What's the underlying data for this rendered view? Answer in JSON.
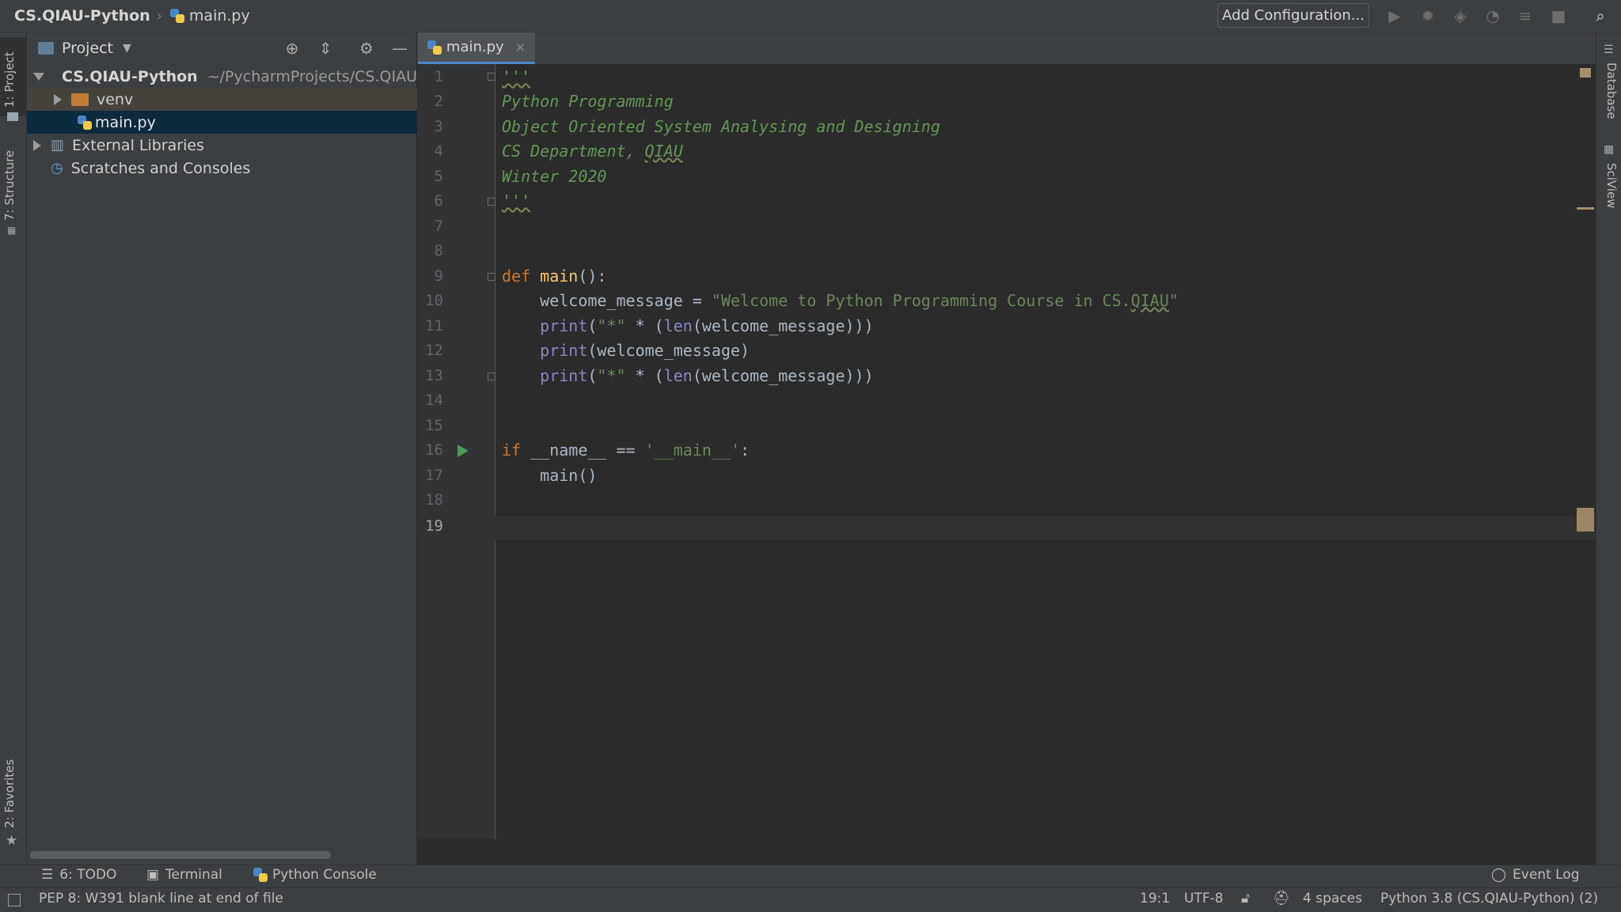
{
  "breadcrumb": {
    "project": "CS.QIAU-Python",
    "file": "main.py"
  },
  "toolbar": {
    "add_configuration": "Add Configuration..."
  },
  "left_strip": {
    "project_tab": "1: Project",
    "structure_tab": "7: Structure",
    "favorites_tab": "2: Favorites"
  },
  "right_strip": {
    "database_tab": "Database",
    "sciview_tab": "SciView"
  },
  "project_panel": {
    "title": "Project",
    "tree": {
      "root_name": "CS.QIAU-Python",
      "root_path": "~/PycharmProjects/CS.QIAU-Python",
      "venv": "venv",
      "main_file": "main.py",
      "external_libraries": "External Libraries",
      "scratches": "Scratches and Consoles"
    }
  },
  "editor": {
    "tab_label": "main.py",
    "line_numbers": [
      "1",
      "2",
      "3",
      "4",
      "5",
      "6",
      "7",
      "8",
      "9",
      "10",
      "11",
      "12",
      "13",
      "14",
      "15",
      "16",
      "17",
      "18",
      "19"
    ],
    "current_line": 19,
    "code": {
      "l1": "'''",
      "l2": "Python Programming",
      "l3": "Object Oriented System Analysing and Designing",
      "l4_a": "CS Department, ",
      "l4_b": "QIAU",
      "l5": "Winter 2020",
      "l6": "'''",
      "l9_kw": "def",
      "l9_fn": "main",
      "l9_rest": "():",
      "l10_a": "    welcome_message = ",
      "l10_str_a": "\"Welcome to Python Programming Course in CS.",
      "l10_str_b": "QIAU",
      "l10_str_c": "\"",
      "l11_pr": "    print",
      "l11_a": "(",
      "l11_str": "\"*\"",
      "l11_b": " * (",
      "l11_len": "len",
      "l11_c": "(welcome_message)))",
      "l12_pr": "    print",
      "l12_a": "(welcome_message)",
      "l13_pr": "    print",
      "l13_a": "(",
      "l13_str": "\"*\"",
      "l13_b": " * (",
      "l13_len": "len",
      "l13_c": "(welcome_message)))",
      "l16_kw": "if",
      "l16_a": " __name__ == ",
      "l16_str": "'__main__'",
      "l16_b": ":",
      "l17": "    main()"
    }
  },
  "bottom_tools": {
    "todo": "6: TODO",
    "terminal": "Terminal",
    "python_console": "Python Console",
    "event_log": "Event Log"
  },
  "status": {
    "message": "PEP 8: W391 blank line at end of file",
    "position": "19:1",
    "encoding": "UTF-8",
    "indent": "4 spaces",
    "interpreter": "Python 3.8 (CS.QIAU-Python) (2)"
  },
  "colors": {
    "accent": "#4a88c7",
    "selection": "#0d293e",
    "docstring": "#629755",
    "keyword": "#cc7832",
    "string": "#6a8759"
  }
}
